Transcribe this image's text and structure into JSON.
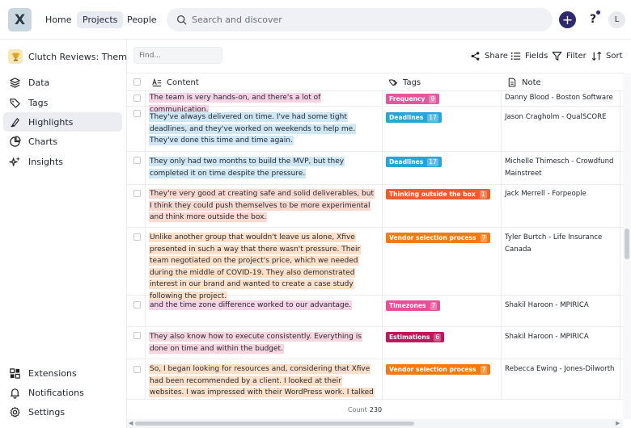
{
  "app": {
    "logo_letter": "X"
  },
  "topnav": {
    "home": "Home",
    "projects": "Projects",
    "people": "People"
  },
  "search": {
    "placeholder": "Search and discover"
  },
  "user": {
    "avatar_initial": "L"
  },
  "help": {
    "label": "?"
  },
  "sidebar": {
    "project_name": "Clutch Reviews: Thema...",
    "items": [
      {
        "label": "Data",
        "icon": "layers-icon"
      },
      {
        "label": "Tags",
        "icon": "tag-icon"
      },
      {
        "label": "Highlights",
        "icon": "highlighter-icon",
        "active": true
      },
      {
        "label": "Charts",
        "icon": "pie-chart-icon"
      },
      {
        "label": "Insights",
        "icon": "sparkles-icon"
      }
    ],
    "bottom_items": [
      {
        "label": "Extensions",
        "icon": "puzzle-icon"
      },
      {
        "label": "Notifications",
        "icon": "bell-icon"
      },
      {
        "label": "Settings",
        "icon": "gear-icon"
      }
    ]
  },
  "toolbar": {
    "find_placeholder": "Find...",
    "share": "Share",
    "fields": "Fields",
    "filter": "Filter",
    "sort": "Sort"
  },
  "columns": {
    "content": "Content",
    "tags": "Tags",
    "note": "Note"
  },
  "colors": {
    "pink_hl": "#f6d3e5",
    "blue_hl": "#cfe6f3",
    "salmon_hl": "#fbd9cf",
    "peach_hl": "#fde0c7",
    "rose_hl": "#f8d6df",
    "tag_frequency": "#e8559f",
    "tag_deadlines": "#26a5d9",
    "tag_thinking": "#f05a32",
    "tag_vendor": "#f47b12",
    "tag_timezones": "#e84f98",
    "tag_estimations": "#c0175c",
    "brand_dark": "#2d2a6b"
  },
  "rows": [
    {
      "content": "The team is very hands-on, and there's a lot of communication.",
      "tag": "Frequency",
      "tag_count": "9",
      "note": "Danny Blood - Boston Software"
    },
    {
      "content": "They've always delivered on time. I've had some tight deadlines, and they've worked on weekends to help me. They've done this time and time again.",
      "tag": "Deadlines",
      "tag_count": "17",
      "note": "Jason Cragholm - QualSCORE"
    },
    {
      "content": "They only had two months to build the MVP, but they completed it on time despite the pressure.",
      "tag": "Deadlines",
      "tag_count": "17",
      "note": "Michelle Thimesch - Crowdfund Mainstreet"
    },
    {
      "content": "They're very good at creating safe and solid deliverables, but I think they could push themselves to be more experimental and think more outside the box.",
      "tag": "Thinking outside the box",
      "tag_count": "1",
      "note": "Jack Merrell - Forpeople"
    },
    {
      "content": "Unlike another group that wouldn't leave us alone, Xfive presented in such a way that there wasn't pressure. Their team negotiated on the project's price, which we needed during the middle of COVID-19. They also demonstrated interest in our brand and wanted to create a case study following the project.",
      "tag": "Vendor selection process",
      "tag_count": "7",
      "note": "Tyler Burtch - Life Insurance Canada"
    },
    {
      "content": "and the time zone difference worked to our advantage.",
      "tag": "Timezones",
      "tag_count": "7",
      "note": "Shakil Haroon - MPIRICA"
    },
    {
      "content": "They also know how to execute consistently. Everything is done on time and within the budget.",
      "tag": "Estimations",
      "tag_count": "6",
      "note": "Shakil Haroon - MPIRICA"
    },
    {
      "content": "So, I began looking for resources and, considering that Xfive had been recommended by a client. I looked at their websites. I was impressed with their WordPress work. I talked to them and they blew me away in our first",
      "tag": "Vendor selection process",
      "tag_count": "7",
      "note": "Rebecca Ewing - Jones-Dilworth"
    }
  ],
  "footer": {
    "count_label": "Count",
    "count_value": "230"
  }
}
